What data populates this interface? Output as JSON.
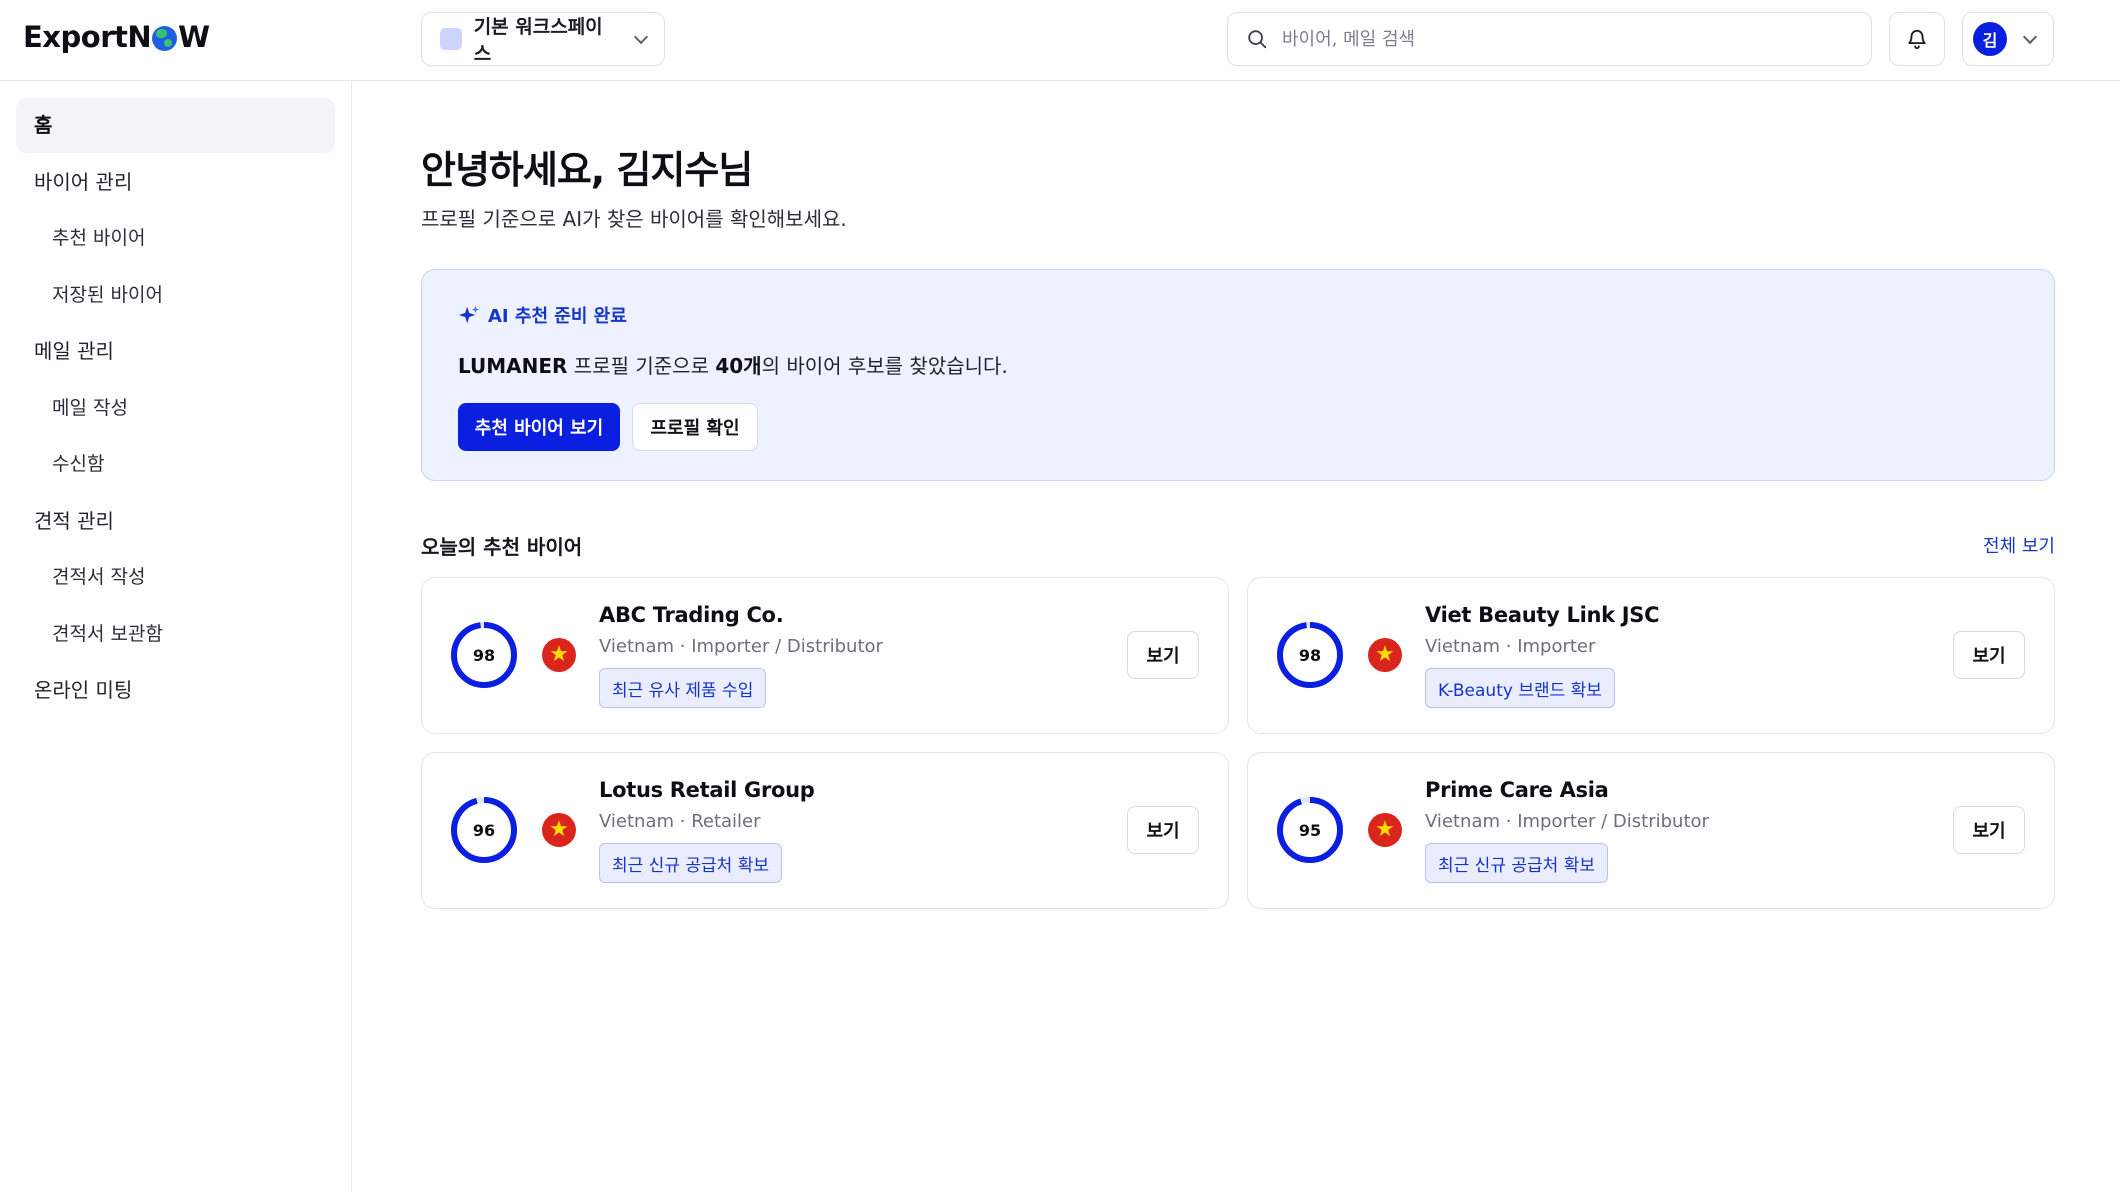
{
  "header": {
    "logo_pre": "Export",
    "logo_post": "W",
    "logo_n": "N",
    "workspace": "기본 워크스페이스",
    "search_placeholder": "바이어, 메일 검색",
    "avatar_initial": "김"
  },
  "sidebar": {
    "items": [
      {
        "label": "홈",
        "active": true
      },
      {
        "label": "바이어 관리"
      },
      {
        "label": "추천 바이어"
      },
      {
        "label": "저장된 바이어"
      },
      {
        "label": "메일 관리"
      },
      {
        "label": "메일 작성"
      },
      {
        "label": "수신함"
      },
      {
        "label": "견적 관리"
      },
      {
        "label": "견적서 작성"
      },
      {
        "label": "견적서 보관함"
      },
      {
        "label": "온라인 미팅"
      }
    ]
  },
  "main": {
    "greeting": "안녕하세요, 김지수님",
    "subtitle": "프로필 기준으로 AI가 찾은 바이어를 확인해보세요."
  },
  "banner": {
    "title": "AI 추천 준비 완료",
    "company": "LUMANER",
    "text_mid": " 프로필 기준으로 ",
    "count": "40개",
    "text_end": "의 바이어 후보를 찾았습니다.",
    "primary_button": "추천 바이어 보기",
    "secondary_button": "프로필 확인"
  },
  "recommendations": {
    "title": "오늘의 추천 바이어",
    "view_all": "전체 보기",
    "view_label": "보기",
    "cards": [
      {
        "score": 98,
        "name": "ABC Trading Co.",
        "meta": "Vietnam · Importer / Distributor",
        "tag": "최근 유사 제품 수입"
      },
      {
        "score": 98,
        "name": "Viet Beauty Link JSC",
        "meta": "Vietnam · Importer",
        "tag": "K-Beauty 브랜드 확보"
      },
      {
        "score": 96,
        "name": "Lotus Retail Group",
        "meta": "Vietnam · Retailer",
        "tag": "최근 신규 공급처 확보"
      },
      {
        "score": 95,
        "name": "Prime Care Asia",
        "meta": "Vietnam · Importer / Distributor",
        "tag": "최근 신규 공급처 확보"
      }
    ]
  },
  "colors": {
    "accent": "#0a1fe0",
    "accent_text": "#1535c9",
    "banner_bg": "#eef1ff",
    "flag_red": "#da251d",
    "flag_star": "#ffdd00"
  }
}
